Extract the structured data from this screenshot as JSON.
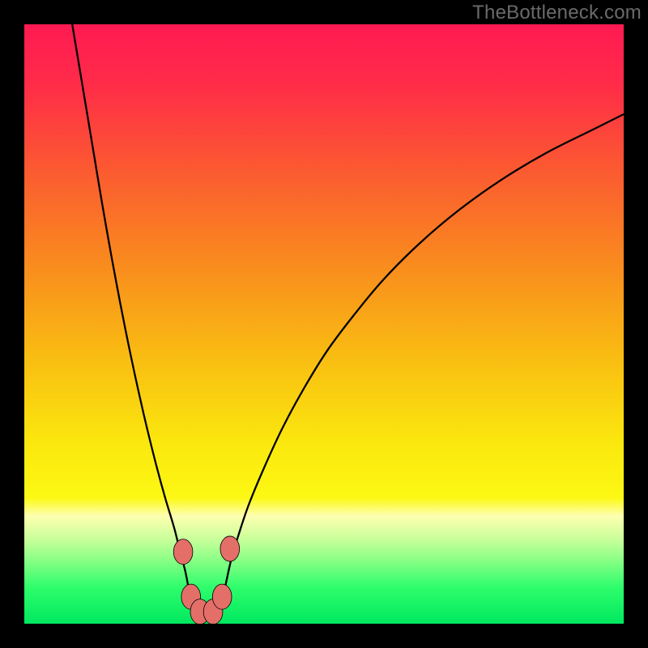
{
  "watermark": "TheBottleneck.com",
  "chart_data": {
    "type": "line",
    "title": "",
    "xlabel": "",
    "ylabel": "",
    "xlim": [
      0,
      100
    ],
    "ylim": [
      0,
      100
    ],
    "grid": false,
    "axes_drawn": false,
    "background_gradient": {
      "stops": [
        {
          "offset": 0.0,
          "color": "#ff1a52"
        },
        {
          "offset": 0.1,
          "color": "#ff2c48"
        },
        {
          "offset": 0.25,
          "color": "#fb5c30"
        },
        {
          "offset": 0.4,
          "color": "#f98b1e"
        },
        {
          "offset": 0.55,
          "color": "#f9bb12"
        },
        {
          "offset": 0.7,
          "color": "#fbe80e"
        },
        {
          "offset": 0.79,
          "color": "#fcf814"
        },
        {
          "offset": 0.82,
          "color": "#feffb0"
        },
        {
          "offset": 0.86,
          "color": "#c8ff9a"
        },
        {
          "offset": 0.9,
          "color": "#7dff82"
        },
        {
          "offset": 0.94,
          "color": "#2dfd6c"
        },
        {
          "offset": 1.0,
          "color": "#00e85f"
        }
      ]
    },
    "series": [
      {
        "name": "left-branch",
        "stroke": "#000000",
        "stroke_width": 2.3,
        "x": [
          8.0,
          9.0,
          10.0,
          11.5,
          13.0,
          14.5,
          16.0,
          17.5,
          19.0,
          20.5,
          22.0,
          23.5,
          25.0,
          26.0,
          26.8,
          27.3,
          27.6
        ],
        "y": [
          100.0,
          94.0,
          88.0,
          79.0,
          70.0,
          61.5,
          53.5,
          46.0,
          39.0,
          32.5,
          26.5,
          21.0,
          16.0,
          12.0,
          9.0,
          6.5,
          4.5
        ]
      },
      {
        "name": "right-branch",
        "stroke": "#000000",
        "stroke_width": 2.3,
        "x": [
          33.2,
          33.8,
          34.6,
          35.8,
          37.5,
          40.0,
          43.0,
          46.5,
          50.5,
          55.0,
          60.0,
          66.0,
          72.5,
          79.5,
          87.0,
          95.0,
          100.0
        ],
        "y": [
          4.5,
          7.5,
          11.0,
          15.0,
          20.0,
          26.0,
          32.5,
          39.0,
          45.5,
          51.5,
          57.5,
          63.5,
          69.0,
          74.0,
          78.5,
          82.5,
          85.0
        ]
      }
    ],
    "markers": {
      "name": "valley-markers",
      "fill": "#e46f69",
      "stroke": "#000000",
      "stroke_width": 0.8,
      "rx": 1.6,
      "ry": 2.1,
      "points": [
        {
          "x": 26.5,
          "y": 12.0
        },
        {
          "x": 27.8,
          "y": 4.5
        },
        {
          "x": 29.3,
          "y": 2.0
        },
        {
          "x": 31.5,
          "y": 2.0
        },
        {
          "x": 33.0,
          "y": 4.5
        },
        {
          "x": 34.3,
          "y": 12.5
        }
      ]
    }
  }
}
